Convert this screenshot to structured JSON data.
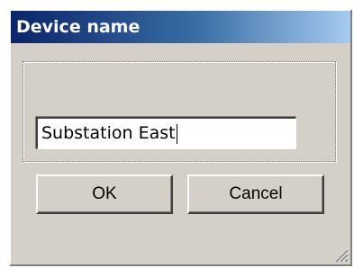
{
  "dialog": {
    "title": "Device name"
  },
  "name_field": {
    "value": "Substation East"
  },
  "buttons": {
    "ok_label": "OK",
    "cancel_label": "Cancel"
  },
  "icons": {
    "resize_grip": "size-grip-icon"
  }
}
